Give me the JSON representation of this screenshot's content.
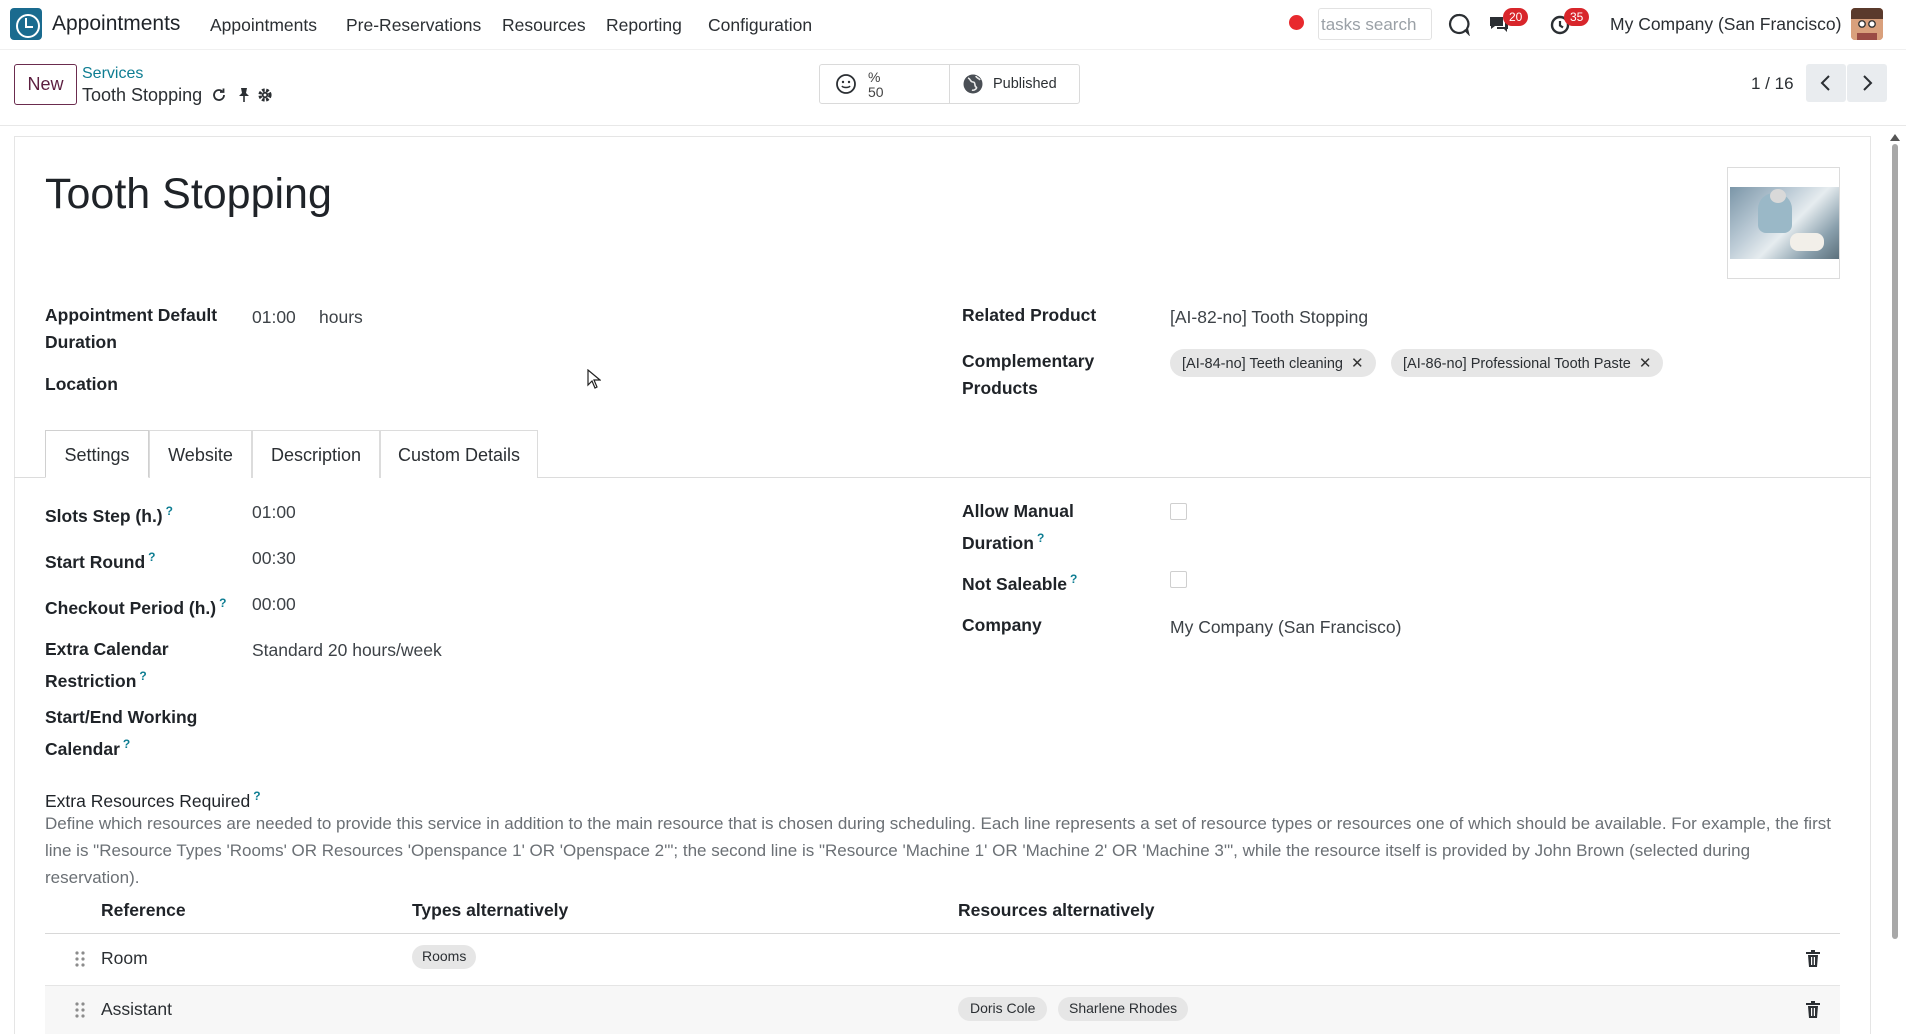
{
  "topbar": {
    "app_name": "Appointments",
    "menu": [
      "Appointments",
      "Pre-Reservations",
      "Resources",
      "Reporting",
      "Configuration"
    ],
    "search_placeholder": "tasks search",
    "messages_count": "20",
    "activities_count": "35",
    "company": "My Company (San Francisco)"
  },
  "control": {
    "new_label": "New",
    "breadcrumb_parent": "Services",
    "breadcrumb_current": "Tooth Stopping",
    "rating_top": "%",
    "rating_value": "50",
    "published_label": "Published",
    "pager": "1 / 16"
  },
  "record": {
    "title": "Tooth Stopping",
    "fields_left": {
      "duration_label": "Appointment Default Duration",
      "duration_value": "01:00",
      "duration_unit": "hours",
      "location_label": "Location"
    },
    "fields_right": {
      "related_product_label": "Related Product",
      "related_product_value": "[AI-82-no] Tooth Stopping",
      "complementary_label": "Complementary Products",
      "complementary_tags": [
        "[AI-84-no] Teeth cleaning",
        "[AI-86-no] Professional Tooth Paste"
      ]
    }
  },
  "tabs": [
    "Settings",
    "Website",
    "Description",
    "Custom Details"
  ],
  "settings": {
    "slots_step_label": "Slots Step (h.)",
    "slots_step_value": "01:00",
    "start_round_label": "Start Round",
    "start_round_value": "00:30",
    "checkout_label": "Checkout Period (h.)",
    "checkout_value": "00:00",
    "extra_cal_label": "Extra Calendar Restriction",
    "extra_cal_value": "Standard 20 hours/week",
    "start_end_label": "Start/End Working Calendar",
    "allow_manual_label": "Allow Manual Duration",
    "allow_manual_checked": false,
    "not_saleable_label": "Not Saleable",
    "not_saleable_checked": false,
    "company_label": "Company",
    "company_value": "My Company (San Francisco)",
    "help_mark": "?"
  },
  "extra_resources": {
    "label": "Extra Resources Required",
    "description": "Define which resources are needed to provide this service in addition to the main resource that is chosen during scheduling. Each line represents a set of resource types or resources one of which should be available. For example, the first line is \"Resource Types 'Rooms' OR Resources 'Openspance 1' OR 'Openspace 2'\"; the second line is \"Resource 'Machine 1' OR 'Machine 2' OR 'Machine 3'\", while the resource itself is provided by John Brown (selected during reservation).",
    "columns": [
      "Reference",
      "Types alternatively",
      "Resources alternatively"
    ],
    "rows": [
      {
        "reference": "Room",
        "types": [
          "Rooms"
        ],
        "resources": []
      },
      {
        "reference": "Assistant",
        "types": [],
        "resources": [
          "Doris Cole",
          "Sharlene Rhodes"
        ]
      }
    ]
  }
}
